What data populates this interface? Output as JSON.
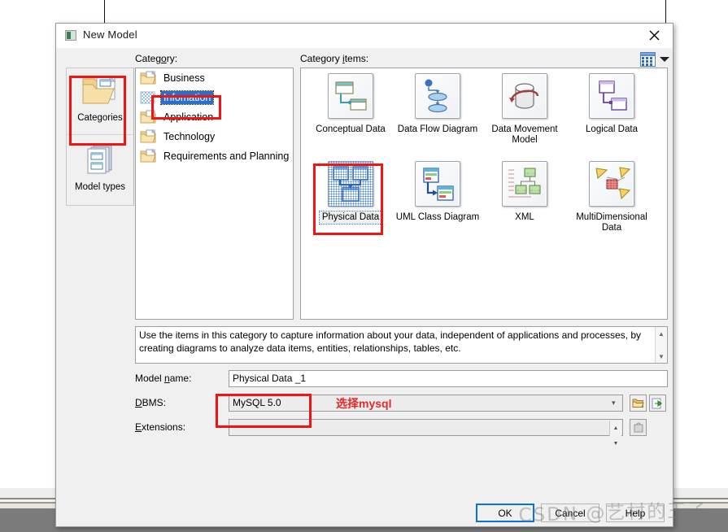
{
  "window": {
    "title": "New Model",
    "app_icon": "model-icon",
    "close_icon": "close-icon"
  },
  "modebar": {
    "items": [
      {
        "label": "Categories",
        "icon": "folder-documents-icon",
        "selected": true
      },
      {
        "label": "Model types",
        "icon": "stacked-documents-icon",
        "selected": false
      }
    ]
  },
  "labels": {
    "category": "Category:",
    "category_items": "Category items:",
    "view_toggle_icon": "view-layout-icon",
    "view_caret_icon": "chevron-down-icon"
  },
  "categories": [
    {
      "label": "Business",
      "icon": "folder-icon",
      "selected": false
    },
    {
      "label": "Infomation",
      "icon": "folder-transparent-icon",
      "selected": true
    },
    {
      "label": "Application",
      "icon": "folder-icon",
      "selected": false
    },
    {
      "label": "Technology",
      "icon": "folder-icon",
      "selected": false
    },
    {
      "label": "Requirements and Planning",
      "icon": "folder-icon",
      "selected": false
    }
  ],
  "category_items": [
    {
      "label": "Conceptual Data",
      "icon": "conceptual-data-icon",
      "selected": false
    },
    {
      "label": "Data Flow Diagram",
      "icon": "data-flow-diagram-icon",
      "selected": false
    },
    {
      "label": "Data Movement Model",
      "icon": "data-movement-model-icon",
      "selected": false
    },
    {
      "label": "Logical Data",
      "icon": "logical-data-icon",
      "selected": false
    },
    {
      "label": "Physical Data",
      "icon": "physical-data-icon",
      "selected": true
    },
    {
      "label": "UML Class Diagram",
      "icon": "uml-class-diagram-icon",
      "selected": false
    },
    {
      "label": "XML",
      "icon": "xml-icon",
      "selected": false
    },
    {
      "label": "MultiDimensional Data",
      "icon": "multidimensional-data-icon",
      "selected": false
    }
  ],
  "description": "Use the items in this category to capture information about your data, independent of applications and processes, by creating diagrams to analyze data items, entities, relationships, tables, etc.",
  "form": {
    "model_name_label": "Model name:",
    "model_name_value": "Physical Data _1",
    "dbms_label": "DBMS:",
    "dbms_value": "MySQL 5.0",
    "dbms_folder_icon": "folder-open-icon",
    "dbms_import_icon": "import-arrow-icon",
    "extensions_label": "Extensions:",
    "extensions_value": "",
    "extensions_button_icon": "extension-icon"
  },
  "footer": {
    "ok_label": "OK",
    "cancel_label": "Cancel",
    "help_label": "Help"
  },
  "annotation": {
    "note": "选择mysql",
    "color": "#e12b2b"
  },
  "watermark": "CSDN @艺村的王子",
  "colors": {
    "accent": "#2a6fc9",
    "annotation_red": "#f01414",
    "default_button_border": "#0a72d1",
    "dialog_bg": "#f0f0f0"
  }
}
